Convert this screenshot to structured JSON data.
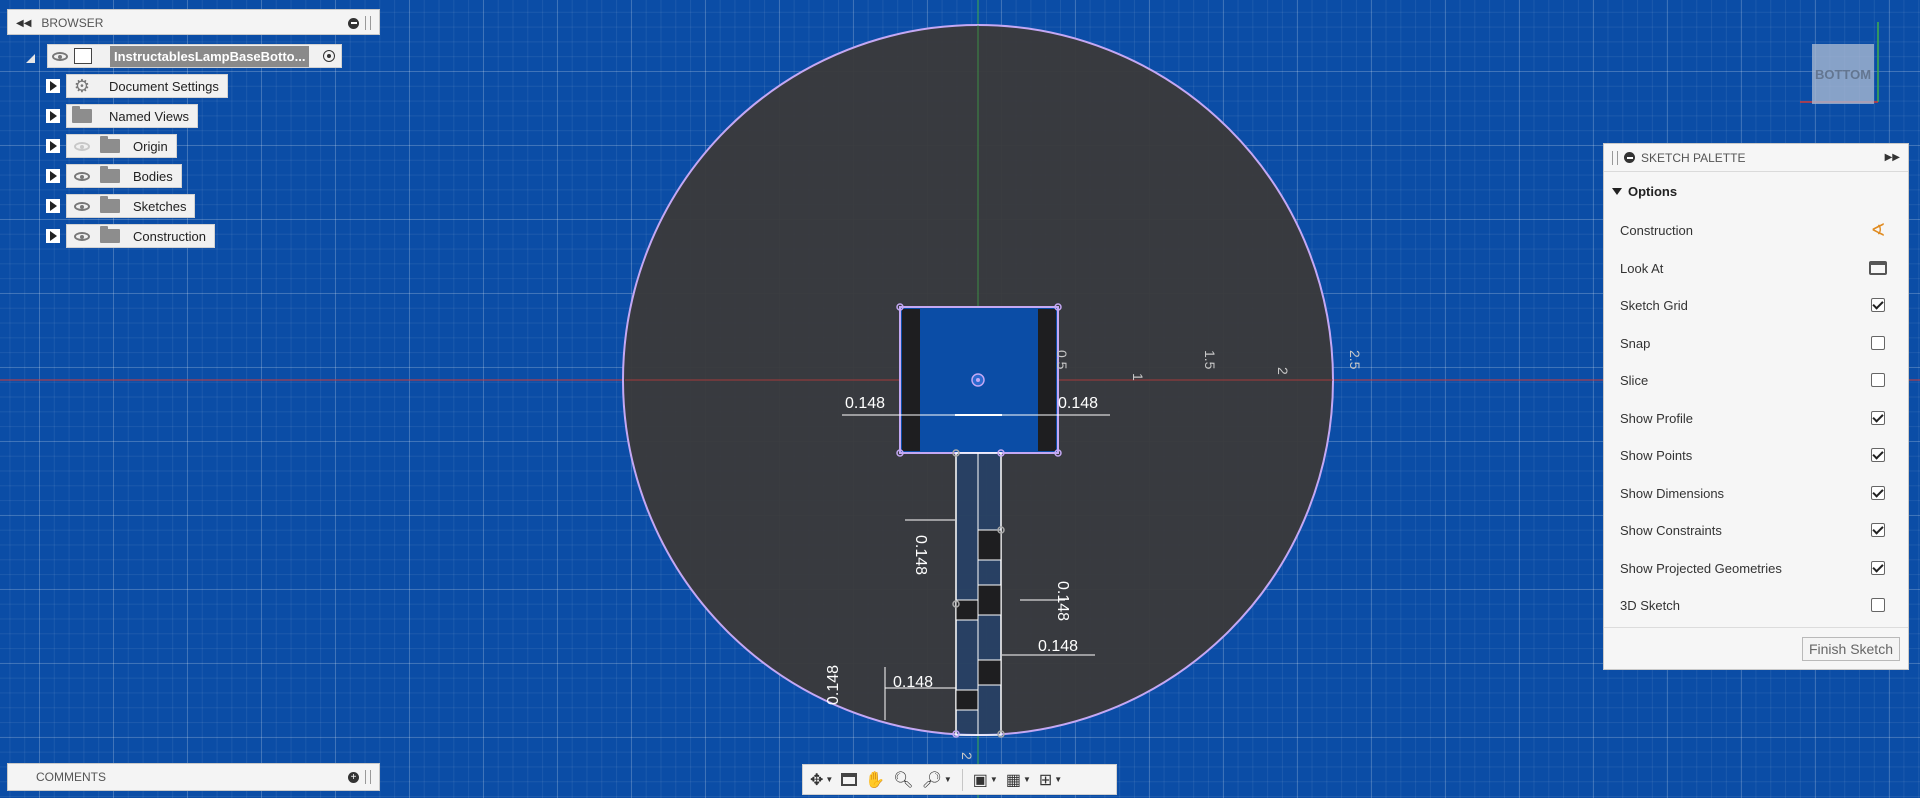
{
  "browser": {
    "title": "BROWSER",
    "root_label": "InstructablesLampBaseBotto...",
    "items": [
      {
        "label": "Document Settings",
        "icon": "gear-icon"
      },
      {
        "label": "Named Views",
        "icon": "folder-icon"
      },
      {
        "label": "Origin",
        "icon": "folder-icon",
        "visibility": "hidden"
      },
      {
        "label": "Bodies",
        "icon": "folder-icon",
        "visibility": "visible"
      },
      {
        "label": "Sketches",
        "icon": "folder-icon",
        "visibility": "visible"
      },
      {
        "label": "Construction",
        "icon": "folder-icon",
        "visibility": "visible"
      }
    ]
  },
  "comments": {
    "title": "COMMENTS"
  },
  "palette": {
    "title": "SKETCH PALETTE",
    "section": "Options",
    "options": [
      {
        "label": "Construction",
        "control": "icon",
        "icon": "construction-icon"
      },
      {
        "label": "Look At",
        "control": "icon",
        "icon": "look-at-icon"
      },
      {
        "label": "Sketch Grid",
        "control": "checkbox",
        "checked": true
      },
      {
        "label": "Snap",
        "control": "checkbox",
        "checked": false
      },
      {
        "label": "Slice",
        "control": "checkbox",
        "checked": false
      },
      {
        "label": "Show Profile",
        "control": "checkbox",
        "checked": true
      },
      {
        "label": "Show Points",
        "control": "checkbox",
        "checked": true
      },
      {
        "label": "Show Dimensions",
        "control": "checkbox",
        "checked": true
      },
      {
        "label": "Show Constraints",
        "control": "checkbox",
        "checked": true
      },
      {
        "label": "Show Projected Geometries",
        "control": "checkbox",
        "checked": true
      },
      {
        "label": "3D Sketch",
        "control": "checkbox",
        "checked": false
      }
    ],
    "finish_label": "Finish Sketch"
  },
  "viewcube": {
    "face_label": "BOTTOM"
  },
  "sketch": {
    "axis_labels": [
      "0.5",
      "1",
      "1.5",
      "2",
      "2.5"
    ],
    "dimensions": [
      "0.148",
      "0.148",
      "0.148",
      "0.148",
      "0.148",
      "0.148",
      "0.148"
    ],
    "bottom_label": "2"
  },
  "colors": {
    "canvas_bg": "#0b4da6",
    "profile_fill": "#3a3a3c",
    "profile_edge": "#c4a8f4",
    "x_axis": "#cf3a3a",
    "y_axis": "#3fae4a"
  },
  "navbar": {
    "tools": [
      "orbit-icon",
      "look-at-icon",
      "pan-icon",
      "zoom-icon",
      "fit-icon",
      "display-settings-icon",
      "grid-settings-icon",
      "viewports-icon"
    ]
  }
}
